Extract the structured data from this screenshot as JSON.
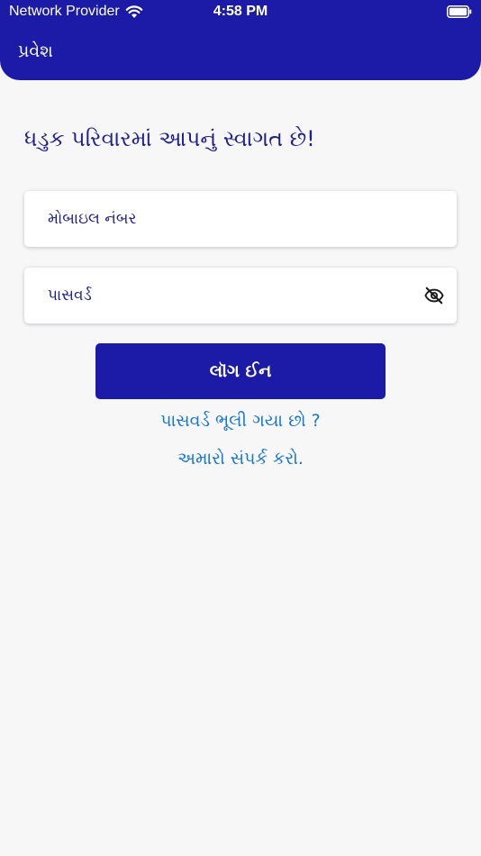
{
  "status_bar": {
    "carrier": "Network Provider",
    "time": "4:58 PM",
    "wifi_icon": "wifi-icon",
    "battery_icon": "battery-icon"
  },
  "header": {
    "title": "પ્રવેશ",
    "background_color": "#1b1ba8"
  },
  "welcome_message": "ધડુક પરિવારમાં આપનું સ્વાગત છે!",
  "form": {
    "mobile": {
      "placeholder": "મોબાઇલ નંબર",
      "value": ""
    },
    "password": {
      "placeholder": "પાસવર્ડ",
      "value": "",
      "toggle_icon": "eye-off-icon"
    },
    "login_label": "લૉગ ઈન"
  },
  "links": {
    "forgot_password": "પાસવર્ડ ભૂલી ગયા છો ?",
    "contact_us": "અમારો સંપર્ક કરો."
  },
  "colors": {
    "primary": "#1b1ba8",
    "text_dark": "#20208f",
    "link": "#1676d2",
    "background": "#f7f7f8"
  }
}
